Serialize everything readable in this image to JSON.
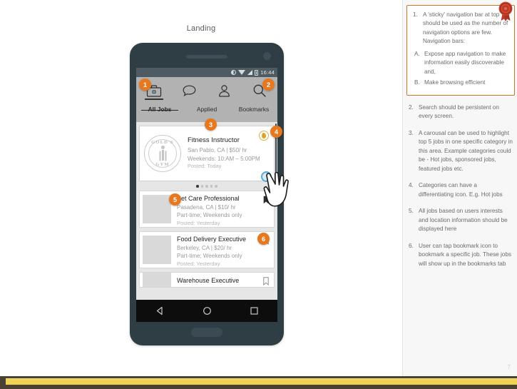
{
  "screen": {
    "title": "Landing",
    "page_number": "7"
  },
  "phone": {
    "statusbar": {
      "time": "16:44",
      "icons": [
        "brightness-icon",
        "wifi-icon",
        "signal-icon",
        "battery-icon"
      ]
    },
    "nav_icons": [
      {
        "name": "briefcase-icon",
        "active": true
      },
      {
        "name": "chat-bubble-icon",
        "active": false
      },
      {
        "name": "person-icon",
        "active": false
      },
      {
        "name": "search-icon",
        "active": false
      }
    ],
    "tabs": [
      {
        "label": "All Jobs",
        "active": true
      },
      {
        "label": "Applied",
        "active": false
      },
      {
        "label": "Bookmarks",
        "active": false
      }
    ],
    "featured": {
      "logo_top": "GOLD'S",
      "logo_bottom": "GYM",
      "title": "Fitness Instructor",
      "location_pay": "San Pablo, CA | $50/ hr",
      "schedule": "Weekends: 10:AM – 5:00PM",
      "posted": "Posted: Today",
      "badge_icon": "flame-icon"
    },
    "carousel": {
      "total_dots": 5,
      "active_index": 0
    },
    "jobs": [
      {
        "title": "Pet Care Professional",
        "location_pay": "Pasadena, CA | $10/ hr",
        "schedule": "Part-time; Weekends only",
        "posted": "Posted: Yesterday",
        "bookmarked": true
      },
      {
        "title": "Food Delivery Executive",
        "location_pay": "Berkeley, CA | $20/ hr",
        "schedule": "Part-time; Weekends only",
        "posted": "Posted: Yesterday",
        "bookmarked": false
      },
      {
        "title": "Warehouse Executive",
        "location_pay": "",
        "schedule": "",
        "posted": "",
        "bookmarked": false
      }
    ],
    "android_nav": [
      "back-icon",
      "home-icon",
      "recents-icon"
    ]
  },
  "annotations": {
    "callout": {
      "items": [
        {
          "num": "1.",
          "text": "A 'sticky' navigation bar at top should be used as the number of navigation options are few. Navigation bars:"
        },
        {
          "num": "A.",
          "text": "Expose app navigation to make information easily discoverable and,",
          "sub": true
        },
        {
          "num": "B.",
          "text": "Make browsing efficient",
          "sub": true
        }
      ]
    },
    "notes": [
      {
        "num": "2.",
        "text": "Search should be persistent on every screen."
      },
      {
        "num": "3.",
        "text": "A carousal can be used to highlight top 5 jobs in one specific category in this area. Example categories could be - Hot jobs, sponsored jobs, featured jobs etc."
      },
      {
        "num": "4.",
        "text": "Categories can have a differentiating icon. E.g. Hot jobs"
      },
      {
        "num": "5.",
        "text": "All jobs based on users interests and location information should be displayed here"
      },
      {
        "num": "6.",
        "text": "User can tap bookmark icon to bookmark a specific job. These jobs will show up in the bookmarks tab"
      }
    ]
  },
  "badges": {
    "b1": "1",
    "b2": "2",
    "b3": "3",
    "b4": "4",
    "b5": "5",
    "b6": "6"
  },
  "colors": {
    "badge": "#e8781e",
    "callout_border": "#c8762a",
    "phone_body": "#2f3d45",
    "bottom_bar": "#efd154"
  }
}
